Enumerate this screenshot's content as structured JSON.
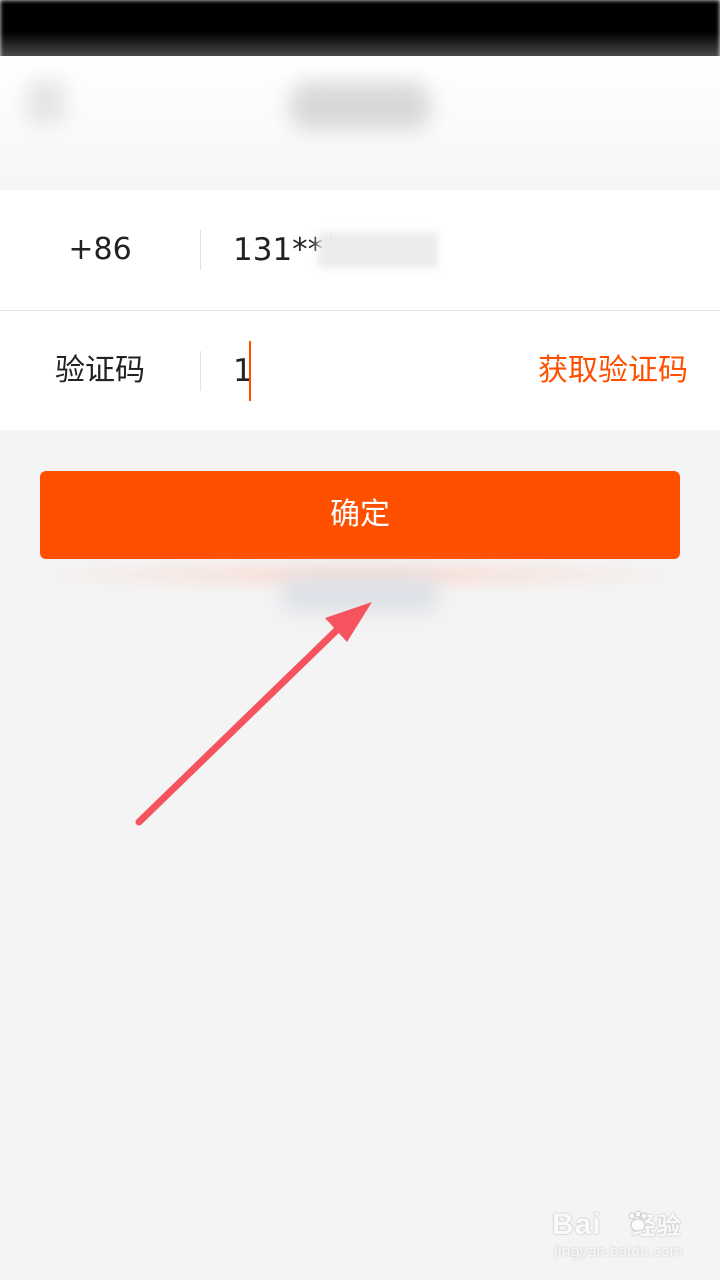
{
  "form": {
    "phone": {
      "country_code": "+86",
      "value": "131***"
    },
    "code": {
      "label": "验证码",
      "value": "1",
      "get_code_label": "获取验证码"
    }
  },
  "actions": {
    "confirm_label": "确定"
  },
  "annotation": {
    "arrow_color": "#f5545e"
  },
  "watermark": {
    "logo_text": "Bai",
    "logo_suffix": "经验",
    "sub_text": "jingyan.baidu.com"
  },
  "colors": {
    "accent": "#ff5000",
    "background": "#f4f4f4",
    "card": "#ffffff"
  }
}
